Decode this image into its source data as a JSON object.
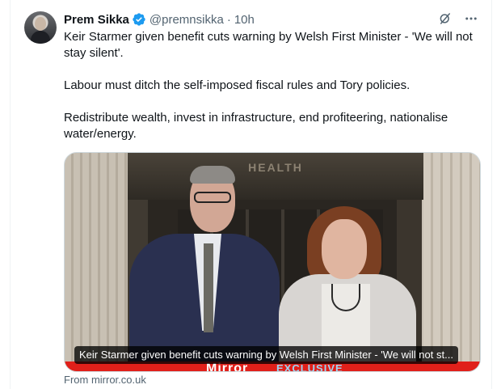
{
  "author": {
    "name": "Prem Sikka",
    "handle": "@premnsikka",
    "separator": "·",
    "time": "10h",
    "verified": true,
    "verified_color": "#1d9bf0"
  },
  "tweet": {
    "paragraphs": [
      "Keir Starmer given benefit cuts warning by Welsh First Minister - 'We will not stay silent'.",
      "Labour must ditch the self-imposed fiscal rules and Tory policies.",
      "Redistribute wealth, invest in infrastructure, end profiteering, nationalise water/energy."
    ]
  },
  "card": {
    "image_sign_text": "HEALTH",
    "overlay_title": "Keir Starmer given benefit cuts warning by Welsh First Minister - 'We will not st...",
    "banner_brand": "Mirror",
    "banner_tag": "EXCLUSIVE",
    "source": "From mirror.co.uk"
  },
  "icons": {
    "verified": "verified-badge-icon",
    "grok": "grok-icon",
    "more": "more-options-icon"
  }
}
